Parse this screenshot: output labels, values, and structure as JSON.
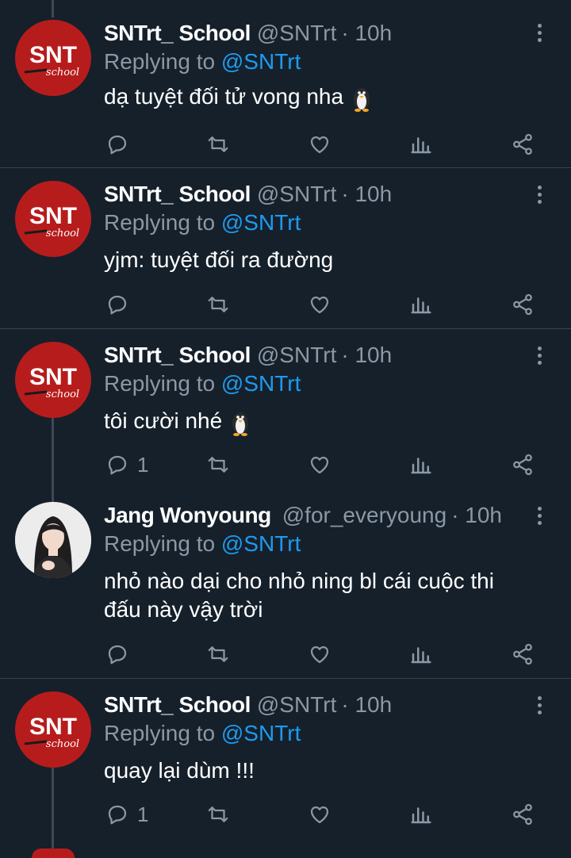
{
  "colors": {
    "background": "#15202b",
    "divider": "#38444d",
    "muted_text": "#8b98a5",
    "mention_blue": "#1d9bf0",
    "snt_red": "#b71c1c"
  },
  "tweets": [
    {
      "author_name": "SNTrt_ School",
      "handle": "@SNTrt",
      "time": "· 10h",
      "replying_prefix": "Replying to",
      "replying_to": "@SNTrt",
      "text": "dạ tuyệt đối tử vong nha",
      "emoji": "penguin",
      "reply_count": "",
      "avatar": "snt-school-logo"
    },
    {
      "author_name": "SNTrt_ School",
      "handle": "@SNTrt",
      "time": "· 10h",
      "replying_prefix": "Replying to",
      "replying_to": "@SNTrt",
      "text": "yjm: tuyệt đối ra đường",
      "emoji": "",
      "reply_count": "",
      "avatar": "snt-school-logo"
    },
    {
      "author_name": "SNTrt_ School",
      "handle": "@SNTrt",
      "time": "· 10h",
      "replying_prefix": "Replying to",
      "replying_to": "@SNTrt",
      "text": "tôi cười nhé",
      "emoji": "penguin",
      "reply_count": "1",
      "avatar": "snt-school-logo"
    },
    {
      "author_name": "Jang Wonyoung",
      "handle": "@for_everyoung",
      "time": "· 10h",
      "replying_prefix": "Replying to",
      "replying_to": "@SNTrt",
      "text": "nhỏ nào dại cho nhỏ ning bl cái cuộc thi đấu này vậy trời",
      "emoji": "",
      "reply_count": "",
      "avatar": "profile-photo"
    },
    {
      "author_name": "SNTrt_ School",
      "handle": "@SNTrt",
      "time": "· 10h",
      "replying_prefix": "Replying to",
      "replying_to": "@SNTrt",
      "text": "quay lại dùm !!!",
      "emoji": "",
      "reply_count": "1",
      "avatar": "snt-school-logo"
    }
  ],
  "logo": {
    "main": "SNT",
    "script": "school"
  },
  "action_icons": [
    "reply-icon",
    "retweet-icon",
    "like-icon",
    "analytics-icon",
    "share-icon"
  ]
}
